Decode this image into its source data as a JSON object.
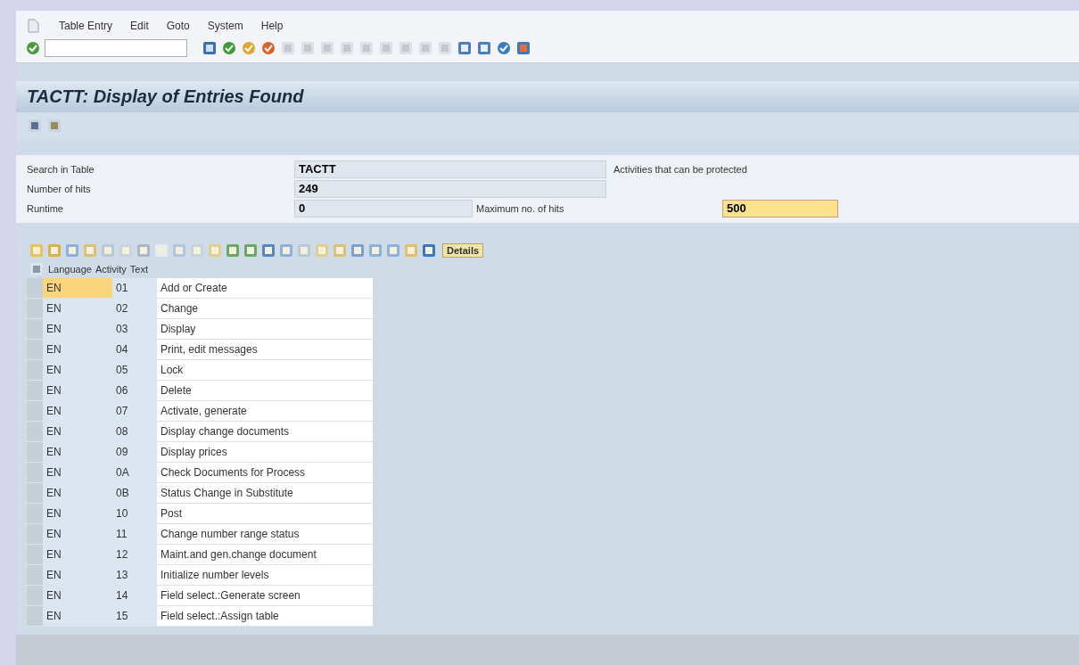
{
  "menu": [
    "Table Entry",
    "Edit",
    "Goto",
    "System",
    "Help"
  ],
  "title": "TACTT: Display of Entries Found",
  "form": [
    {
      "label": "Search in Table",
      "value": "TACTT",
      "note": "Activities that can be protected"
    },
    {
      "label": "Number of hits",
      "value": "249"
    },
    {
      "label": "Runtime",
      "value": "0",
      "extra_label": "Maximum no. of hits",
      "extra_value": "500"
    }
  ],
  "details_button": "Details",
  "table": {
    "columns": [
      "Language",
      "Activity",
      "Text"
    ],
    "rows": [
      {
        "language": "EN",
        "activity": "01",
        "text": "Add or Create",
        "selected": true
      },
      {
        "language": "EN",
        "activity": "02",
        "text": "Change",
        "selected": false
      },
      {
        "language": "EN",
        "activity": "03",
        "text": "Display",
        "selected": false
      },
      {
        "language": "EN",
        "activity": "04",
        "text": "Print, edit messages",
        "selected": false
      },
      {
        "language": "EN",
        "activity": "05",
        "text": "Lock",
        "selected": false
      },
      {
        "language": "EN",
        "activity": "06",
        "text": "Delete",
        "selected": false
      },
      {
        "language": "EN",
        "activity": "07",
        "text": "Activate, generate",
        "selected": false
      },
      {
        "language": "EN",
        "activity": "08",
        "text": "Display change documents",
        "selected": false
      },
      {
        "language": "EN",
        "activity": "09",
        "text": "Display prices",
        "selected": false
      },
      {
        "language": "EN",
        "activity": "0A",
        "text": "Check Documents for Process",
        "selected": false
      },
      {
        "language": "EN",
        "activity": "0B",
        "text": "Status Change in Substitute",
        "selected": false
      },
      {
        "language": "EN",
        "activity": "10",
        "text": "Post",
        "selected": false
      },
      {
        "language": "EN",
        "activity": "11",
        "text": "Change number range status",
        "selected": false
      },
      {
        "language": "EN",
        "activity": "12",
        "text": "Maint.and gen.change document",
        "selected": false
      },
      {
        "language": "EN",
        "activity": "13",
        "text": "Initialize number levels",
        "selected": false
      },
      {
        "language": "EN",
        "activity": "14",
        "text": "Field select.:Generate screen",
        "selected": false
      },
      {
        "language": "EN",
        "activity": "15",
        "text": "Field select.:Assign table",
        "selected": false
      }
    ]
  }
}
